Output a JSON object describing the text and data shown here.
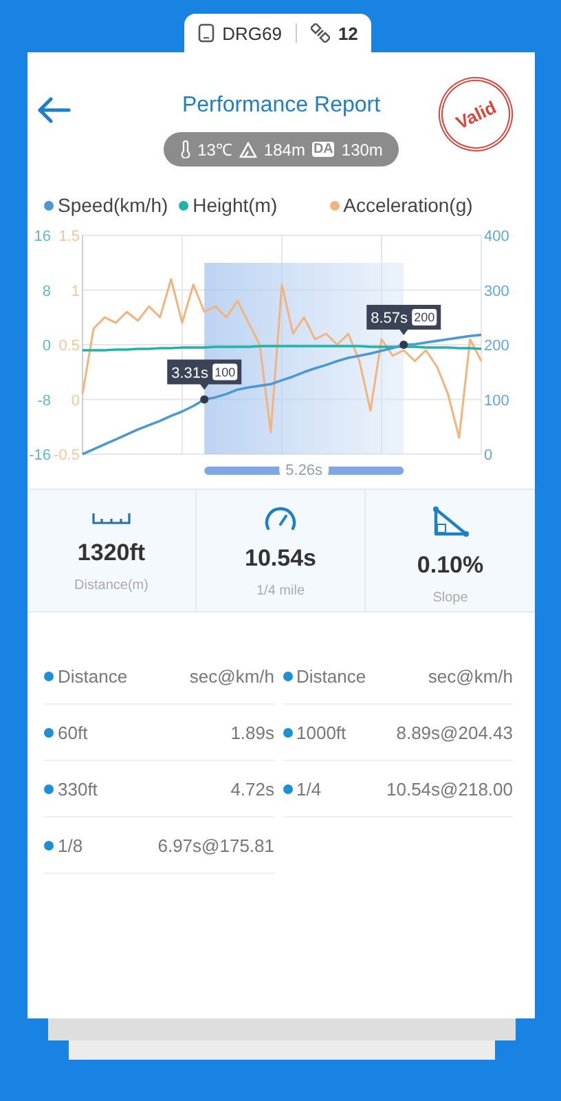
{
  "device_bar": {
    "device": "DRG69",
    "satellites": "12"
  },
  "header": {
    "title": "Performance Report",
    "stamp": "Valid"
  },
  "conditions": {
    "temperature": "13℃",
    "altitude": "184m",
    "da_badge": "DA",
    "density_altitude": "130m"
  },
  "chart": {
    "chart_data": {
      "type": "line",
      "grid": true,
      "ylim": [
        0,
        400
      ],
      "yticks": [
        400,
        300,
        200,
        100,
        0
      ],
      "y2lim": [
        -16,
        16
      ],
      "y2ticks": [
        16,
        8,
        0,
        -8,
        -16
      ],
      "y3lim": [
        -0.5,
        1.5
      ],
      "y3ticks": [
        1.5,
        1,
        0.5,
        0,
        -0.5
      ],
      "series": [
        {
          "name": "Speed(km/h)",
          "color": "#4a98d4",
          "values": [
            0,
            9,
            18,
            27,
            36,
            45,
            53,
            61,
            70,
            78,
            88,
            100,
            104,
            110,
            118,
            122,
            125,
            128,
            135,
            142,
            150,
            157,
            163,
            170,
            176,
            180,
            184,
            189,
            194,
            200,
            201,
            204,
            207,
            210,
            213,
            216,
            218
          ]
        },
        {
          "name": "Height(m)",
          "color": "#22b3a8",
          "axis": "y2",
          "values": [
            -0.8,
            -0.8,
            -0.8,
            -0.7,
            -0.7,
            -0.6,
            -0.6,
            -0.5,
            -0.5,
            -0.4,
            -0.4,
            -0.4,
            -0.3,
            -0.3,
            -0.3,
            -0.3,
            -0.2,
            -0.2,
            -0.2,
            -0.2,
            -0.2,
            -0.2,
            -0.2,
            -0.2,
            -0.2,
            -0.2,
            -0.3,
            -0.3,
            -0.3,
            -0.3,
            -0.3,
            -0.4,
            -0.4,
            -0.4,
            -0.5,
            -0.5,
            -0.6
          ]
        },
        {
          "name": "Acceleration(g)",
          "color": "#f2b47c",
          "axis": "y3",
          "values": [
            0.05,
            0.65,
            0.75,
            0.7,
            0.8,
            0.72,
            0.85,
            0.75,
            1.1,
            0.7,
            1.05,
            0.8,
            0.85,
            0.75,
            0.9,
            0.7,
            0.5,
            -0.3,
            1.05,
            0.6,
            0.75,
            0.55,
            0.6,
            0.5,
            0.6,
            0.35,
            -0.1,
            0.55,
            0.4,
            0.45,
            0.35,
            0.45,
            0.3,
            0.05,
            -0.35,
            0.55,
            0.35
          ]
        }
      ]
    },
    "markers": [
      {
        "time": "3.31s",
        "reading": "100"
      },
      {
        "time": "8.57s",
        "reading": "200"
      }
    ],
    "selection": {
      "duration": "5.26s"
    }
  },
  "stats": [
    {
      "kind": "ruler",
      "value": "1320ft",
      "label": "Distance(m)"
    },
    {
      "kind": "gauge",
      "value": "10.54s",
      "label": "1/4 mile"
    },
    {
      "kind": "slope",
      "value": "0.10%",
      "label": "Slope"
    }
  ],
  "splits": {
    "left": [
      {
        "label": "Distance",
        "value": "sec@km/h"
      },
      {
        "label": "60ft",
        "value": "1.89s"
      },
      {
        "label": "330ft",
        "value": "4.72s"
      },
      {
        "label": "1/8",
        "value": "6.97s@175.81"
      }
    ],
    "right": [
      {
        "label": "Distance",
        "value": "sec@km/h"
      },
      {
        "label": "1000ft",
        "value": "8.89s@204.43"
      },
      {
        "label": "1/4",
        "value": "10.54s@218.00"
      }
    ]
  }
}
